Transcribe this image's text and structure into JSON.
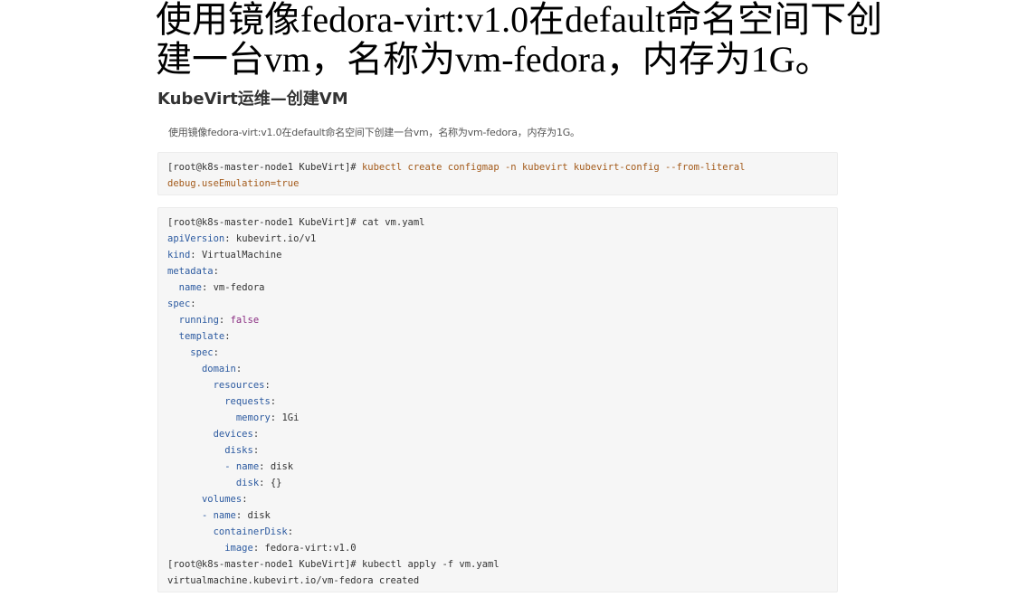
{
  "headline": {
    "line1": "使用镜像fedora-virt:v1.0在default命名空间下创",
    "line2": "建一台vm，名称为vm-fedora，内存为1G。"
  },
  "section": {
    "title": "KubeVirt运维—创建VM",
    "description": "使用镜像fedora-virt:v1.0在default命名空间下创建一台vm，名称为vm-fedora，内存为1G。"
  },
  "code_block_1": {
    "prompt": "[root@k8s-master-node1 KubeVirt]#",
    "command_line1": " kubectl create configmap -n kubevirt kubevirt-config --from-literal",
    "command_line2": "debug.useEmulation=true"
  },
  "code_block_2": {
    "prompt": "[root@k8s-master-node1 KubeVirt]#",
    "cat_cmd": " cat vm.yaml",
    "yaml": {
      "apiVersion_key": "apiVersion",
      "apiVersion_val": "kubevirt.io/v1",
      "kind_key": "kind",
      "kind_val": "VirtualMachine",
      "metadata_key": "metadata",
      "name_key": "name",
      "name_val": "vm-fedora",
      "spec_key": "spec",
      "running_key": "running",
      "running_val": "false",
      "template_key": "template",
      "inner_spec_key": "spec",
      "domain_key": "domain",
      "resources_key": "resources",
      "requests_key": "requests",
      "memory_key": "memory",
      "memory_val": "1Gi",
      "devices_key": "devices",
      "disks_key": "disks",
      "disk_name_key": "name",
      "disk_name_val": "disk",
      "disk_key": "disk",
      "disk_val": "{}",
      "volumes_key": "volumes",
      "vol_name_key": "name",
      "vol_name_val": "disk",
      "containerDisk_key": "containerDisk",
      "image_key": "image",
      "image_val": "fedora-virt:v1.0"
    },
    "apply_cmd": " kubectl apply -f vm.yaml",
    "output": "virtualmachine.kubevirt.io/vm-fedora created"
  }
}
